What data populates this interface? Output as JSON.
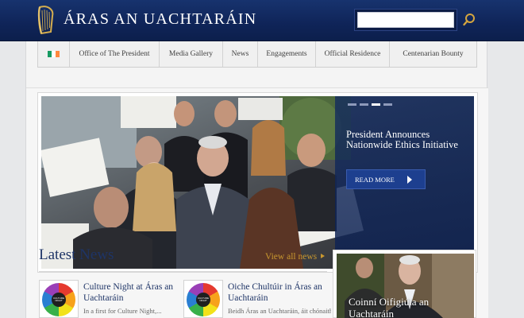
{
  "header": {
    "site_title": "ÁRAS AN UACHTARÁIN",
    "search": {
      "placeholder": "",
      "value": ""
    },
    "colors": {
      "bar": "#0f2458",
      "accent": "#c9982f"
    }
  },
  "nav": {
    "flag_colors": [
      "#169b62",
      "#ffffff",
      "#ff883e"
    ],
    "items": [
      {
        "label": "Office of The President"
      },
      {
        "label": "Media Gallery"
      },
      {
        "label": "News"
      },
      {
        "label": "Engagements"
      },
      {
        "label": "Official Residence"
      },
      {
        "label": "Centenarian Bounty"
      }
    ]
  },
  "hero": {
    "headline": "President Announces Nationwide Ethics Initiative",
    "read_more": "READ MORE",
    "slides": 4,
    "active_slide": 3
  },
  "news": {
    "section_title": "Latest News",
    "view_all": "View all news",
    "cards": [
      {
        "title": "Culture Night at Áras an Uachtaráin",
        "excerpt": "In a first for Culture Night,...",
        "thumb_text": "CULTURE NIGHT"
      },
      {
        "title": "Oiche Chultúir in Áras an Uachtaráin",
        "excerpt": "Beidh Áras an Uachtaráin, áit chónaithe",
        "thumb_text": "CULTURE NIGHT"
      }
    ]
  },
  "feature": {
    "title": "Coinní Oifigiúla an Uachtaráin"
  }
}
